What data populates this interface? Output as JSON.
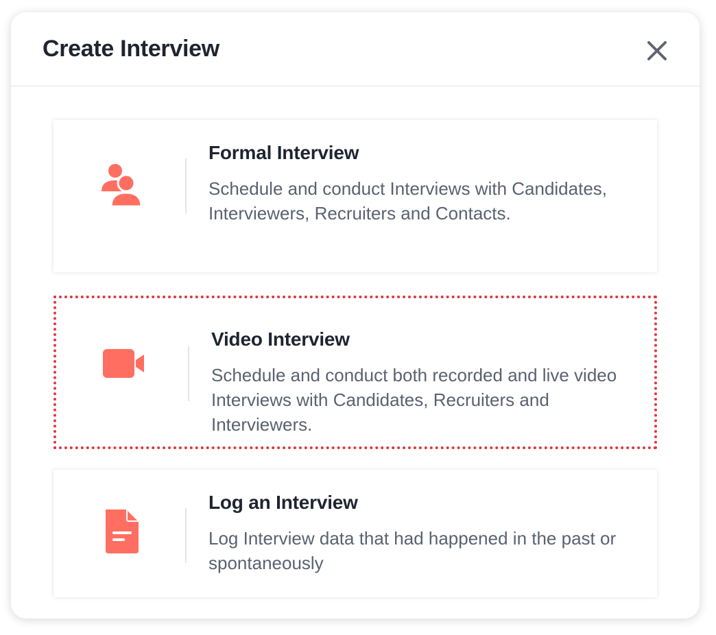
{
  "dialog": {
    "title": "Create Interview",
    "close_icon": "close-icon"
  },
  "options": [
    {
      "title": "Formal Interview",
      "description": "Schedule and conduct Interviews with Candidates, Interviewers, Recruiters and Contacts.",
      "icon": "users-icon"
    },
    {
      "title": "Video Interview",
      "description": "Schedule and conduct both recorded and live video Interviews with Candidates, Recruiters and Interviewers.",
      "icon": "video-camera-icon",
      "selected": true
    },
    {
      "title": "Log an Interview",
      "description": "Log Interview data that had happened in the past or spontaneously",
      "icon": "document-icon"
    }
  ],
  "colors": {
    "accent": "#ff6f61",
    "selection_border": "#e0353d",
    "title_text": "#1f2430",
    "body_text": "#5a6170"
  }
}
